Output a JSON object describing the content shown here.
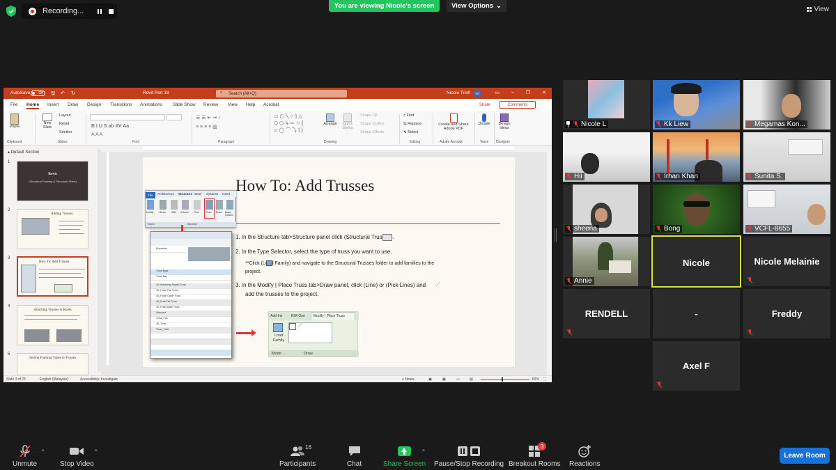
{
  "top_bar": {
    "recording_label": "Recording...",
    "viewing_banner": "You are viewing Nicole's screen",
    "view_options_label": "View Options",
    "view_label": "View"
  },
  "shared_screen": {
    "ppt": {
      "autosave_label": "AutoSave",
      "autosave_state": "Off",
      "doc_title": "Revit  Part 18",
      "search_placeholder": "Search (Alt+Q)",
      "user_name": "Nicole Trish",
      "user_initials": "NT",
      "menu_tabs": [
        "File",
        "Home",
        "Insert",
        "Draw",
        "Design",
        "Transitions",
        "Animations",
        "Slide Show",
        "Review",
        "View",
        "Help",
        "Acrobat"
      ],
      "active_tab": "Home",
      "share_label": "Share",
      "comments_label": "Comments",
      "ribbon_groups": [
        "Clipboard",
        "Slides",
        "Font",
        "Paragraph",
        "Drawing",
        "Editing",
        "Adobe Acrobat",
        "Voice",
        "Designer"
      ],
      "ribbon_items": {
        "paste": "Paste",
        "new_slide": "New Slide",
        "layout": "Layout",
        "reset": "Reset",
        "section": "Section",
        "arrange": "Arrange",
        "quick_styles": "Quick Styles",
        "shape_fill": "Shape Fill",
        "shape_outline": "Shape Outline",
        "shape_effects": "Shape Effects",
        "find": "Find",
        "replace": "Replace",
        "select": "Select",
        "create_pdf": "Create and Share Adobe PDF",
        "dictate": "Dictate",
        "design_ideas": "Design Ideas"
      },
      "section_label": "Default Section",
      "thumbnails": [
        {
          "num": "1",
          "title": "Revit",
          "subtitle": "(Structural Framing & Structural Slabs)"
        },
        {
          "num": "2",
          "title": "Adding Trusses"
        },
        {
          "num": "3",
          "title": "How To: Add Trusses"
        },
        {
          "num": "4",
          "title": "Attaching Trusses to Roofs"
        },
        {
          "num": "5",
          "title": "Setting Framing Types in Trusses"
        }
      ],
      "slide": {
        "title": "How To: Add Trusses",
        "step1": "1.     In the Structure tab>Structure panel click         (Structural Trusses).",
        "step2": "2.     In the Type Selector, select the type of truss you want to use.",
        "note1": "**Click      (Load Family) and navigate to the Structural Trusses folder to add families to the",
        "note2": "project.",
        "step3a": "3.   In the Modify | Place Truss tab>Draw panel, click     (Line) or     (Pick Lines) and",
        "step3b": "add the trusses to the project.",
        "ribbon_shot": {
          "tabs": [
            "File",
            "Architecture",
            "Structure",
            "Steel",
            "Systems",
            "Insert"
          ],
          "tools": [
            "Modify",
            "Beam",
            "Wall",
            "Column",
            "Floor",
            "Truss",
            "Brace",
            "Beam System"
          ],
          "footer": [
            "Select",
            "Structure"
          ]
        },
        "props_rows": [
          "Properties",
          "Truss Bays",
          "Truss Bay",
          "4S_Bowstring Sloped Truss",
          "4S_Howe Flat Truss",
          "4S_Howe Gable Truss",
          "4S_Pratt Flat Truss",
          "4S_Pratt Gable Truss",
          "Standard",
          "Truss_Fan",
          "4S_Truss",
          "Truss_Pratt"
        ],
        "place_shot": {
          "tabs": [
            "Add-Ins",
            "BIM One",
            "Modify | Place Truss"
          ],
          "load_family": "Load Family",
          "footer": [
            "Mode",
            "Draw"
          ]
        }
      },
      "status": {
        "slide_of": "Slide 3 of 23",
        "language": "English (Malaysia)",
        "accessibility": "Accessibility: Investigate",
        "notes": "Notes",
        "zoom": "82%"
      }
    }
  },
  "gallery": [
    {
      "name": "Nicole L",
      "pinned": true,
      "muted": true
    },
    {
      "name": "Kk Liew",
      "muted": true
    },
    {
      "name": "Megamas Kon...",
      "muted": true
    },
    {
      "name": "Hii",
      "muted": true
    },
    {
      "name": "Irhan Khan",
      "muted": true
    },
    {
      "name": "Sunita S.",
      "muted": true
    },
    {
      "name": "sheena",
      "muted": true
    },
    {
      "name": "Bong",
      "muted": true
    },
    {
      "name": "VCFL-8655",
      "muted": true
    },
    {
      "name": "Annie",
      "muted": true
    },
    {
      "name": "Nicole",
      "muted": false
    },
    {
      "name": "Nicole Melainie",
      "muted": true
    },
    {
      "name": "RENDELL",
      "muted": true
    },
    {
      "name": "-",
      "muted": false
    },
    {
      "name": "Freddy",
      "muted": true
    },
    {
      "name": "Axel F",
      "muted": true
    }
  ],
  "toolbar": {
    "unmute": "Unmute",
    "stop_video": "Stop Video",
    "participants": "Participants",
    "participants_count": "16",
    "chat": "Chat",
    "share_screen": "Share Screen",
    "pause_stop_recording": "Pause/Stop Recording",
    "breakout_rooms": "Breakout Rooms",
    "breakout_badge": "3",
    "reactions": "Reactions",
    "leave_room": "Leave Room"
  },
  "colors": {
    "ppt_accent": "#c43e1c",
    "banner_green": "#22c55e",
    "leave_blue": "#1a6fd8",
    "mute_red": "#e03a3a",
    "active_speaker": "#d8e34a"
  }
}
